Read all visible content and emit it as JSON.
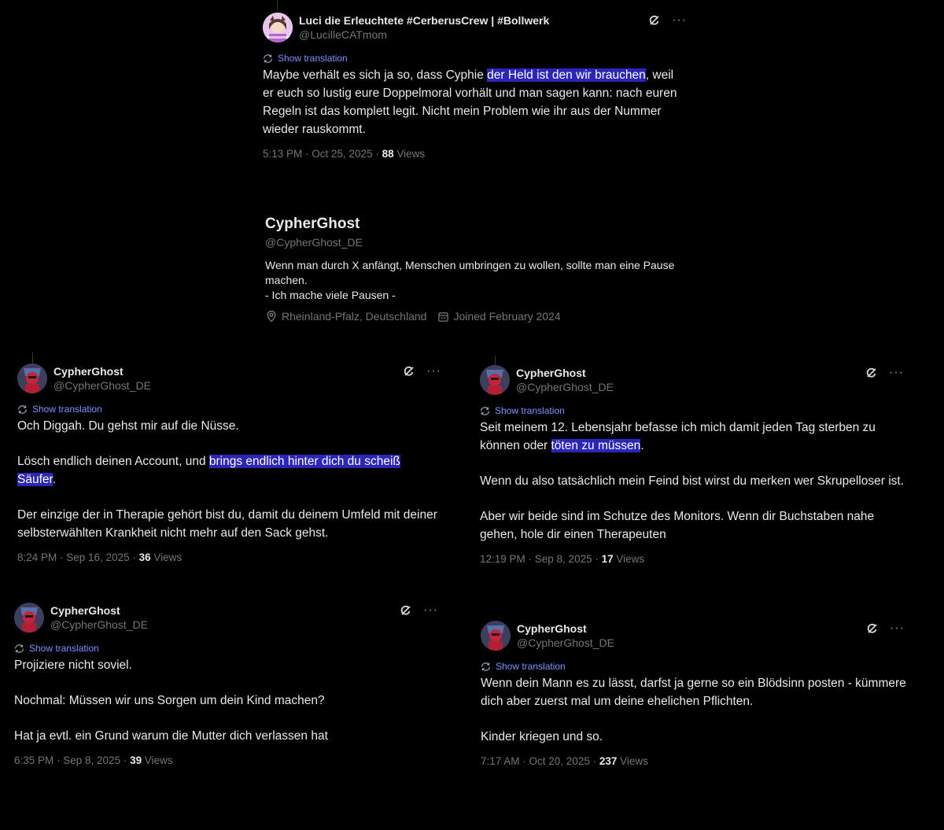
{
  "top_tweet": {
    "display_name": "Luci die Erleuchtete #CerberusCrew | #Bollwerk",
    "handle": "@LucilleCATmom",
    "show_translation": "Show translation",
    "text_a": "Maybe verhält es sich ja so, dass Cyphie ",
    "text_hl": "der Held ist den wir brauchen",
    "text_b": ", weil er euch so lustig eure Doppelmoral vorhält und man sagen kann: nach euren Regeln ist das komplett legit. Nicht mein Problem wie ihr aus der Nummer wieder rauskommt.",
    "timestamp": "5:13 PM · Oct 25, 2025 · ",
    "views_count": "88",
    "views_label": " Views"
  },
  "profile": {
    "name": "CypherGhost",
    "handle": "@CypherGhost_DE",
    "bio": "Wenn man durch X anfängt, Menschen umbringen zu wollen, sollte man eine Pause machen.\n- Ich mache viele Pausen -",
    "location": "Rheinland-Pfalz, Deutschland",
    "joined": "Joined February 2024"
  },
  "tweet_left_1": {
    "display_name": "CypherGhost",
    "handle": "@CypherGhost_DE",
    "show_translation": "Show translation",
    "p1": "Och Diggah. Du gehst mir auf die Nüsse.",
    "p2_a": "Lösch endlich deinen Account, und ",
    "p2_hl": "brings endlich hinter dich du scheiß Säufer",
    "p2_b": ".",
    "p3": "Der einzige der in Therapie gehört bist du, damit du deinem Umfeld mit deiner selbsterwählten Krankheit nicht mehr auf den Sack gehst.",
    "timestamp": "8:24 PM · Sep 16, 2025 · ",
    "views_count": "36",
    "views_label": " Views"
  },
  "tweet_left_2": {
    "display_name": "CypherGhost",
    "handle": "@CypherGhost_DE",
    "show_translation": "Show translation",
    "p1": "Projiziere nicht soviel.",
    "p2": "Nochmal: Müssen wir uns Sorgen um dein Kind machen?",
    "p3": "Hat ja evtl. ein Grund warum die Mutter dich verlassen hat",
    "timestamp": "6:35 PM · Sep 8, 2025 · ",
    "views_count": "39",
    "views_label": " Views"
  },
  "tweet_right_1": {
    "display_name": "CypherGhost",
    "handle": "@CypherGhost_DE",
    "show_translation": "Show translation",
    "p1_a": "Seit meinem 12. Lebensjahr befasse ich mich damit jeden Tag sterben zu können oder ",
    "p1_hl": "töten zu müssen",
    "p1_b": ".",
    "p2": "Wenn du also tatsächlich mein Feind bist wirst du merken wer Skrupelloser ist.",
    "p3": "Aber wir beide sind im Schutze des Monitors. Wenn dir Buchstaben nahe gehen, hole dir einen Therapeuten",
    "timestamp": "12:19 PM · Sep 8, 2025 · ",
    "views_count": "17",
    "views_label": " Views"
  },
  "tweet_right_2": {
    "display_name": "CypherGhost",
    "handle": "@CypherGhost_DE",
    "show_translation": "Show translation",
    "p1": "Wenn dein Mann es zu lässt, darfst ja gerne so ein Blödsinn posten - kümmere dich aber zuerst mal um deine ehelichen Pflichten.",
    "p2": "Kinder kriegen und so.",
    "timestamp": "7:17 AM · Oct 20, 2025 · ",
    "views_count": "237",
    "views_label": " Views"
  },
  "icons": {
    "translate": "translate-icon",
    "grok": "grok-icon",
    "more": "more-icon",
    "location": "location-pin-icon",
    "calendar": "calendar-icon"
  },
  "colors": {
    "background": "#000000",
    "highlight": "#2b25b8",
    "link": "#7a94ff",
    "secondary_text": "#71767b"
  }
}
